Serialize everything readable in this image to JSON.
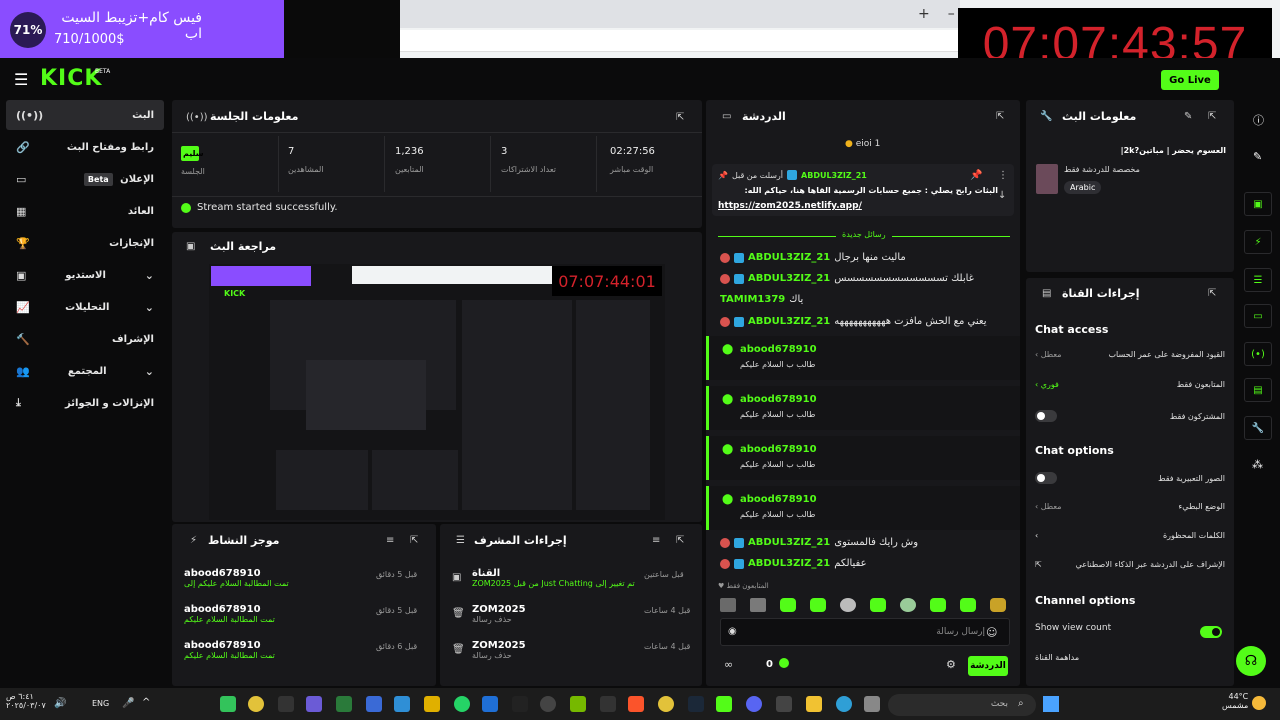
{
  "goal": {
    "title": "فيس كام+تزيبط السيت اب",
    "progress": "710/1000$",
    "percent_label": "71%"
  },
  "clock": "07:07:43:57",
  "brand": {
    "logo": "KICK",
    "beta": "BETA",
    "go_live": "Go Live"
  },
  "sidebar": {
    "items": [
      {
        "label": "البث",
        "icon": "broadcast-icon"
      },
      {
        "label": "رابط ومفتاح البث",
        "icon": "link-icon"
      },
      {
        "label": "الإعلان",
        "icon": "ad-icon",
        "badge": "Beta"
      },
      {
        "label": "العائد",
        "icon": "revenue-icon"
      },
      {
        "label": "الإنجازات",
        "icon": "trophy-icon"
      },
      {
        "label": "الاستديو",
        "icon": "studio-icon"
      },
      {
        "label": "التحليلات",
        "icon": "analytics-icon"
      },
      {
        "label": "الإشراف",
        "icon": "moderation-icon"
      },
      {
        "label": "المجتمع",
        "icon": "community-icon"
      },
      {
        "label": "الإنزالات و الجوائز",
        "icon": "drops-icon"
      }
    ]
  },
  "session": {
    "title": "معلومات الجلسة",
    "stats": [
      {
        "value": "02:27:56",
        "label": "الوقت مباشر"
      },
      {
        "value": "3",
        "label": "تعداد الاشتراكات"
      },
      {
        "value": "1,236",
        "label": "المتابعين"
      },
      {
        "value": "7",
        "label": "المشاهدين"
      },
      {
        "value": "سليم",
        "label": "الجلسة"
      }
    ],
    "notice": "Stream started successfully."
  },
  "preview": {
    "title": "مراجعة البث",
    "clock": "07:07:44:01",
    "logo": "KICK"
  },
  "activity": {
    "title": "موجز النشاط",
    "rows": [
      {
        "name": "abood678910",
        "sub": "تمت المطالبة السلام عليكم إلى",
        "time": "قبل 5 دقائق"
      },
      {
        "name": "abood678910",
        "sub": "تمت المطالبة السلام عليكم",
        "time": "قبل 5 دقائق"
      },
      {
        "name": "abood678910",
        "sub": "تمت المطالبة السلام عليكم",
        "time": "قبل 6 دقائق"
      }
    ]
  },
  "mod": {
    "title": "إجراءات المشرف",
    "rows": [
      {
        "name": "القناة",
        "desc": "ZOM2025 من قبل Just Chatting تم تغيير إلى",
        "time": "قبل ساعتين"
      },
      {
        "name": "ZOM2025",
        "desc": "حذف رسالة",
        "time": "قبل 4 ساعات"
      },
      {
        "name": "ZOM2025",
        "desc": "حذف رسالة",
        "time": "قبل 4 ساعات"
      }
    ]
  },
  "chat": {
    "title": "الدردشة",
    "top_user": "eioi 1",
    "pinned": {
      "by": "ABDUL3ZIZ_21",
      "by_label": "أرسلت من قبل",
      "text": "البثات رابح يصلي : جميع حسابات الرسمية القاها هنا، حياكم الله:",
      "link": "https://zom2025.netlify.app/"
    },
    "new_messages": "رسائل جديدة",
    "messages": [
      {
        "user": "ABDUL3ZIZ_21",
        "text": "ماليت منها برجال"
      },
      {
        "user": "ABDUL3ZIZ_21",
        "text": "غابلك تسسسسسسسسسسسس"
      },
      {
        "user": "TAMIM1379",
        "text": "ياك"
      },
      {
        "user": "ABDUL3ZIZ_21",
        "text": "يعني مع الحش مافزت هههههههههههه"
      }
    ],
    "subs": [
      {
        "user": "abood678910",
        "text": "طالب ب السلام عليكم"
      },
      {
        "user": "abood678910",
        "text": "طالب ب السلام عليكم"
      },
      {
        "user": "abood678910",
        "text": "طالب ب السلام عليكم"
      },
      {
        "user": "abood678910",
        "text": "طالب ب السلام عليكم"
      }
    ],
    "tail": [
      {
        "user": "ABDUL3ZIZ_21",
        "text": "وش رايك فالمستوى"
      },
      {
        "user": "ABDUL3ZIZ_21",
        "text": "عفيالكم"
      }
    ],
    "followers_only": "المتابعون فقط",
    "input_placeholder": "إرسال رسالة",
    "points": "0",
    "send": "الدردشة"
  },
  "stream_info": {
    "title": "معلومات البث",
    "stream_title": "العسوم يحضر | مباتين?2k|",
    "category": "مخصصة للدردشة فقط",
    "language": "Arabic"
  },
  "channel_actions": {
    "title": "إجراءات القناة",
    "chat_access": "Chat access",
    "access_rows": [
      {
        "label": "القيود المفروضة على عمر الحساب",
        "value": "معطل"
      },
      {
        "label": "المتابعون فقط",
        "value": "فوري"
      },
      {
        "label": "المشتركون فقط",
        "value": ""
      }
    ],
    "chat_options": "Chat options",
    "option_rows": [
      {
        "label": "الصور التعبيرية فقط",
        "value": ""
      },
      {
        "label": "الوضع البطيء",
        "value": "معطل"
      },
      {
        "label": "الكلمات المحظورة",
        "value": ""
      },
      {
        "label": "الإشراف على الدردشة عبر الذكاء الاصطناعي",
        "value": ""
      }
    ],
    "channel_options": "Channel options",
    "show_view_count": "Show view count",
    "channel_view": "مداهمة القناة"
  },
  "taskbar": {
    "search": "بحث",
    "lang": "ENG",
    "weather": "44°C",
    "weather_sub": "مشمس",
    "time": "٦:٤١ ص",
    "date": "٢٠٢٥/٠٣/٠٧"
  }
}
